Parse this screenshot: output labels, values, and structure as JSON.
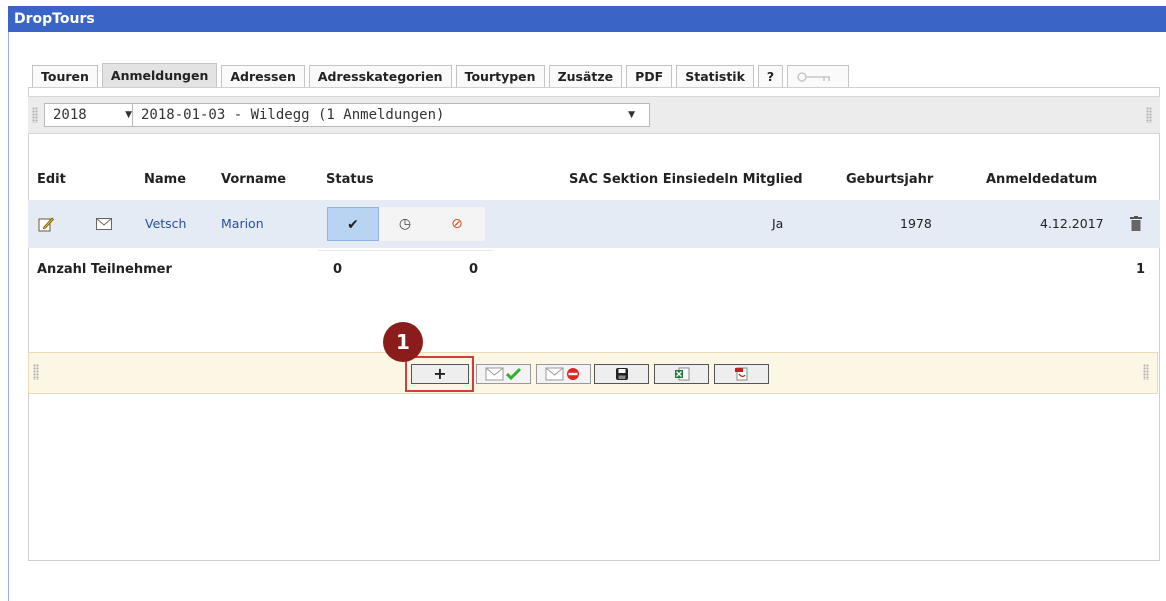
{
  "app": {
    "title": "DropTours"
  },
  "tabs": [
    {
      "label": "Touren"
    },
    {
      "label": "Anmeldungen",
      "active": true
    },
    {
      "label": "Adressen"
    },
    {
      "label": "Adresskategorien"
    },
    {
      "label": "Tourtypen"
    },
    {
      "label": "Zusätze"
    },
    {
      "label": "PDF"
    },
    {
      "label": "Statistik"
    },
    {
      "label": "?"
    },
    {
      "icon": "key-icon",
      "disabled": true
    }
  ],
  "filters": {
    "year": "2018",
    "tour": "2018-01-03 - Wildegg (1 Anmeldungen)"
  },
  "table": {
    "headers": {
      "edit": "Edit",
      "name": "Name",
      "vorname": "Vorname",
      "status": "Status",
      "member": "SAC Sektion Einsiedeln Mitglied",
      "birthyear": "Geburtsjahr",
      "date": "Anmeldedatum"
    },
    "rows": [
      {
        "name": "Vetsch",
        "vorname": "Marion",
        "status": "confirmed",
        "member": "Ja",
        "birthyear": "1978",
        "date": "4.12.2017"
      }
    ],
    "summary": {
      "label": "Anzahl Teilnehmer",
      "pending": "0",
      "cancelled": "0",
      "total": "1"
    }
  },
  "toolbar": {
    "add_label": "+",
    "buttons": [
      "add-button",
      "mail-confirm-button",
      "mail-cancel-button",
      "save-button",
      "excel-export-button",
      "pdf-export-button"
    ]
  },
  "annotation": {
    "number": "1"
  },
  "colors": {
    "titlebar": "#3a64c6",
    "row": "#e5ebf4",
    "toolbar": "#fcf6e4",
    "highlight": "#d83a3a",
    "badge": "#8b1c1c"
  }
}
